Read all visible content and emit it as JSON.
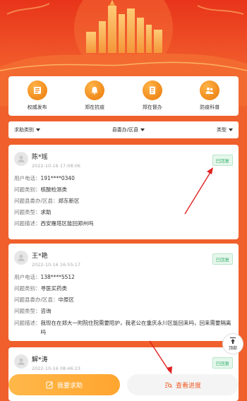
{
  "nav": [
    {
      "label": "权威发布",
      "icon": "news-icon"
    },
    {
      "label": "郑在抗疫",
      "icon": "bell-icon"
    },
    {
      "label": "郑在督办",
      "icon": "document-icon"
    },
    {
      "label": "防疫科普",
      "icon": "people-icon"
    }
  ],
  "filters": {
    "category": "求助类别",
    "district": "县委办/区县",
    "type": "类型"
  },
  "labels": {
    "phone": "用户电话：",
    "category": "问题类别：",
    "district": "问题县委办/区县：",
    "type": "问题类型：",
    "desc": "问题描述："
  },
  "cards": [
    {
      "name": "陈*瑶",
      "time": "2022-10-16 17:08:06",
      "status": "已回复",
      "phone": "191****0340",
      "category": "核酸检测类",
      "district": "郑东新区",
      "type": "求助",
      "desc": "西安雁塔区能回郑州吗"
    },
    {
      "name": "王*艳",
      "time": "2022-10-16 16:55:17",
      "status": "已回复",
      "phone": "138****5512",
      "category": "寻医买药类",
      "district": "中原区",
      "type": "咨询",
      "desc": "我现在在郑大一附院住院需要陪护，我老公在重庆永川区能回来吗，回来需要隔离吗"
    },
    {
      "name": "解*涛",
      "time": "2022-10-16 08:46:23",
      "status": "已回复",
      "phone": "",
      "category": "",
      "district": "",
      "type": "",
      "desc": ""
    }
  ],
  "top_button": "顶部",
  "bottom": {
    "seek_help": "我要求助",
    "view_progress": "查看进度"
  },
  "colors": {
    "accent": "#f0602c",
    "button_orange": "#ffa52f",
    "status_green": "#3cb371"
  }
}
